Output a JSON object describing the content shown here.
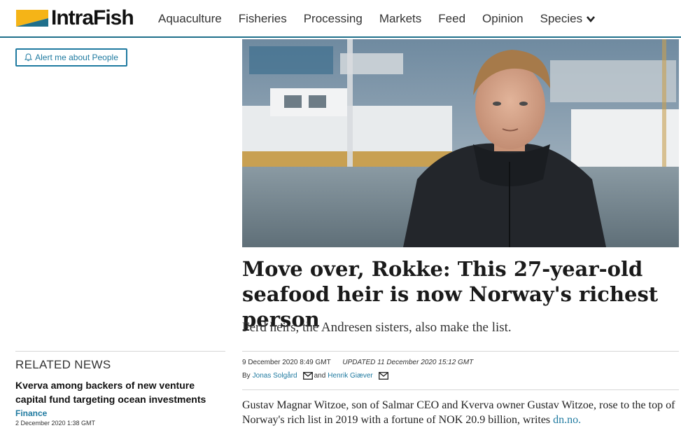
{
  "brand": {
    "name": "IntraFish",
    "accent": "#1f7aa0",
    "logo_yellow": "#f5b417",
    "logo_blue": "#1f6f8b"
  },
  "nav": {
    "items": [
      {
        "label": "Aquaculture"
      },
      {
        "label": "Fisheries"
      },
      {
        "label": "Processing"
      },
      {
        "label": "Markets"
      },
      {
        "label": "Feed"
      },
      {
        "label": "Opinion"
      },
      {
        "label": "Species",
        "icon": "chevron-down-icon"
      }
    ]
  },
  "alert": {
    "label": "Alert me about People",
    "icon": "bell-icon"
  },
  "article": {
    "headline": "Move over, Rokke: This 27-year-old seafood heir is now Norway's richest person",
    "subheadline": "Ferd heirs, the Andresen sisters, also make the list.",
    "published": "9 December 2020 8:49 GMT",
    "updated": "UPDATED  11 December 2020 15:12 GMT",
    "by_label": "By",
    "and_label": "and",
    "authors": [
      "Jonas Solgård",
      "Henrik Giæver"
    ],
    "body_text": "Gustav Magnar Witzoe, son of Salmar CEO and Kverva owner Gustav Witzoe, rose to the top of Norway's rich list in 2019 with a fortune of NOK 20.9 billion, writes ",
    "body_link": "dn.no."
  },
  "related": {
    "title": "RELATED NEWS",
    "items": [
      {
        "headline": "Kverva among backers of new venture capital fund targeting ocean investments",
        "category": "Finance",
        "date": "2 December 2020 1:38 GMT"
      }
    ]
  }
}
